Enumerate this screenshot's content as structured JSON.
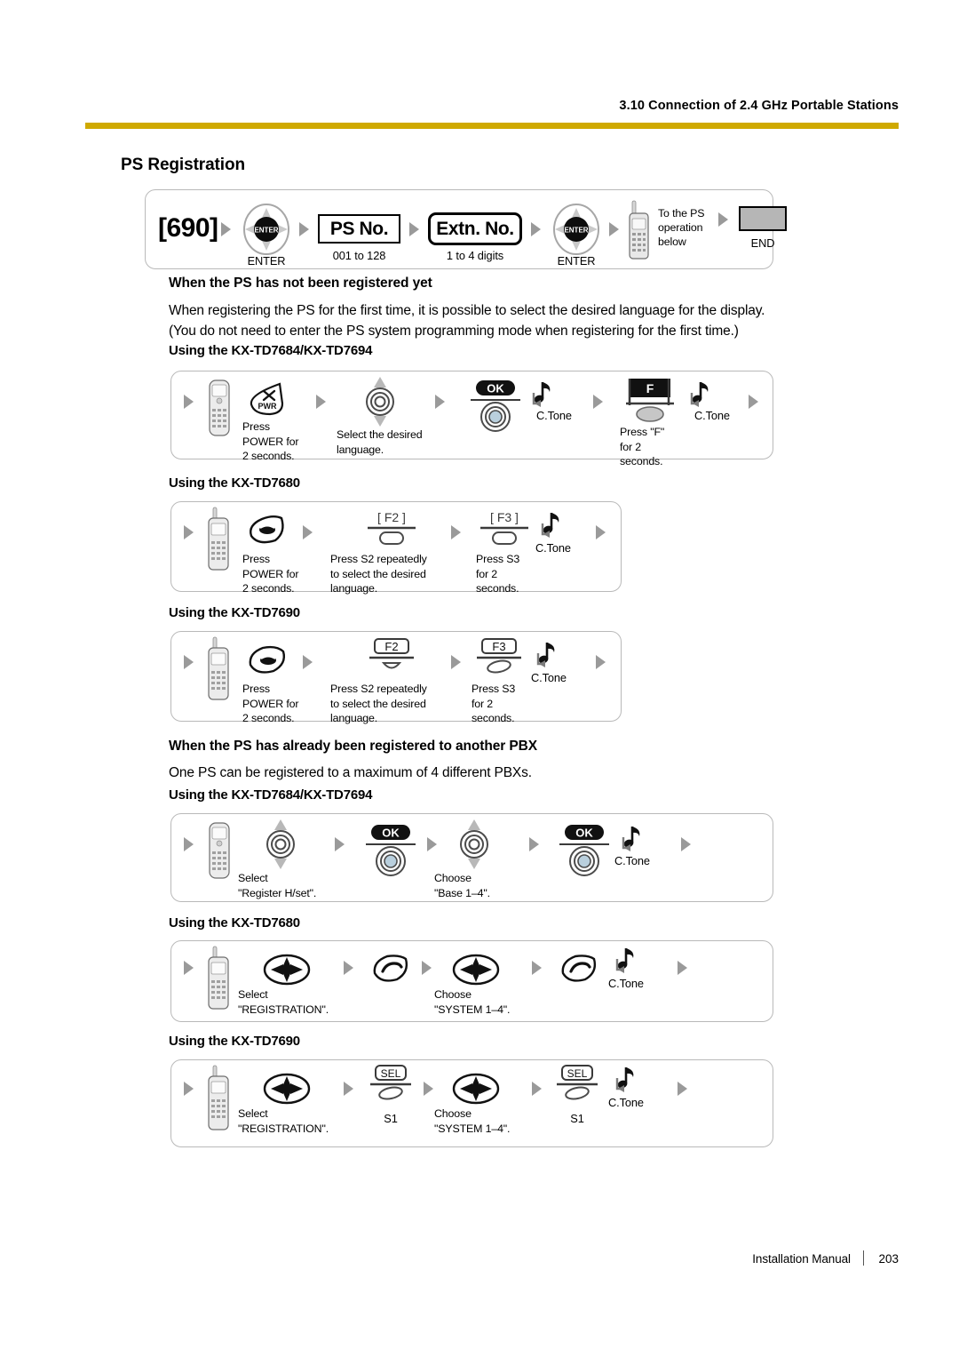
{
  "header": {
    "section_title": "3.10 Connection of 2.4 GHz Portable Stations",
    "rule_color": "#cfa900"
  },
  "page_title": "PS Registration",
  "sections": {
    "not_registered": {
      "heading": "When the PS has not been registered yet",
      "para_line1": "When registering the PS for the first time, it is possible to select the desired language for the display.",
      "para_line2": "(You do not need to enter the PS system programming mode when registering for the first time.)",
      "sub1": "Using the KX-TD7684/KX-TD7694",
      "sub2": "Using the KX-TD7680",
      "sub3": "Using the KX-TD7690"
    },
    "already_registered": {
      "heading": "When the PS has already been registered to another PBX",
      "para_line1": "One PS can be registered to a maximum of 4 different PBXs.",
      "sub1": "Using the KX-TD7684/KX-TD7694",
      "sub2": "Using the KX-TD7680",
      "sub3": "Using the KX-TD7690"
    }
  },
  "flow_main": {
    "code": "[690]",
    "enter1_label": "ENTER",
    "ps_no": "PS No.",
    "ps_no_range": "001 to 128",
    "extn_no": "Extn. No.",
    "extn_no_range": "1 to 4 digits",
    "enter2_label": "ENTER",
    "to_ps_line1": "To the PS",
    "to_ps_line2": "operation",
    "to_ps_line3": "below",
    "end_label": "END"
  },
  "flow_7684_lang": {
    "pwr_key": "PWR",
    "cap_power": "Press\nPOWER for\n2 seconds.",
    "cap_language": "Select the desired\nlanguage.",
    "ok_key": "OK",
    "ctone1": "C.Tone",
    "f_key": "F",
    "cap_f": "Press \"F\"\nfor 2\nseconds.",
    "ctone2": "C.Tone"
  },
  "flow_7680_lang": {
    "cap_power": "Press\nPOWER for\n2 seconds.",
    "f2_key": "[ F2 ]",
    "cap_s2": "Press S2 repeatedly\nto select the desired\nlanguage.",
    "f3_key": "[ F3 ]",
    "cap_s3": "Press S3\nfor 2\nseconds.",
    "ctone": "C.Tone"
  },
  "flow_7690_lang": {
    "cap_power": "Press\nPOWER for\n2 seconds.",
    "f2_key": "F2",
    "cap_s2": "Press S2 repeatedly\nto select the desired\nlanguage.",
    "f3_key": "F3",
    "cap_s3": "Press S3\nfor 2\nseconds.",
    "ctone": "C.Tone"
  },
  "flow_7684_reg": {
    "cap_select": "Select\n\"Register H/set\".",
    "ok_key1": "OK",
    "cap_choose": "Choose\n\"Base 1–4\".",
    "ok_key2": "OK",
    "ctone": "C.Tone"
  },
  "flow_7680_reg": {
    "cap_select": "Select\n\"REGISTRATION\".",
    "cap_choose": "Choose\n\"SYSTEM 1–4\".",
    "ctone": "C.Tone"
  },
  "flow_7690_reg": {
    "cap_select": "Select\n\"REGISTRATION\".",
    "sel_key1": "SEL",
    "s1_label1": "S1",
    "cap_choose": "Choose\n\"SYSTEM 1–4\".",
    "sel_key2": "SEL",
    "s1_label2": "S1",
    "ctone": "C.Tone"
  },
  "footer": {
    "manual": "Installation Manual",
    "page_number": "203"
  }
}
